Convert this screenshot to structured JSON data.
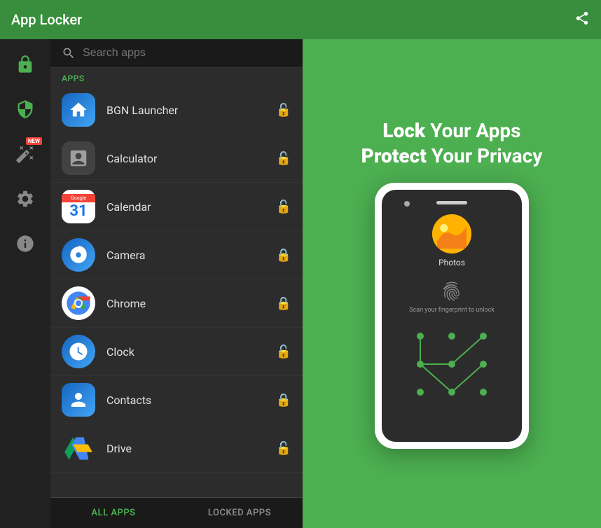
{
  "header": {
    "title": "App Locker",
    "share_icon": "share-icon"
  },
  "sidebar": {
    "icons": [
      {
        "name": "lock-icon",
        "type": "lock"
      },
      {
        "name": "shield-icon",
        "type": "shield"
      },
      {
        "name": "magic-icon",
        "type": "magic",
        "badge": "NEW"
      },
      {
        "name": "settings-icon",
        "type": "settings"
      },
      {
        "name": "info-icon",
        "type": "info"
      }
    ]
  },
  "search": {
    "placeholder": "Search apps"
  },
  "apps_section": {
    "label": "Apps",
    "items": [
      {
        "name": "BGN Launcher",
        "locked": false,
        "icon_type": "bgn"
      },
      {
        "name": "Calculator",
        "locked": false,
        "icon_type": "calc"
      },
      {
        "name": "Calendar",
        "locked": false,
        "icon_type": "calendar"
      },
      {
        "name": "Camera",
        "locked": true,
        "icon_type": "camera"
      },
      {
        "name": "Chrome",
        "locked": true,
        "icon_type": "chrome"
      },
      {
        "name": "Clock",
        "locked": false,
        "icon_type": "clock"
      },
      {
        "name": "Contacts",
        "locked": true,
        "icon_type": "contacts"
      },
      {
        "name": "Drive",
        "locked": false,
        "icon_type": "drive"
      }
    ]
  },
  "tabs": {
    "all_apps": "ALL APPS",
    "locked_apps": "LOCKED APPS"
  },
  "promo": {
    "line1_bold": "Lock",
    "line1_rest": " Your Apps",
    "line2_bold": "Protect",
    "line2_rest": " Your Privacy"
  },
  "phone": {
    "app_label": "Photos",
    "fingerprint_text": "Scan your fingerprint to unlock"
  }
}
